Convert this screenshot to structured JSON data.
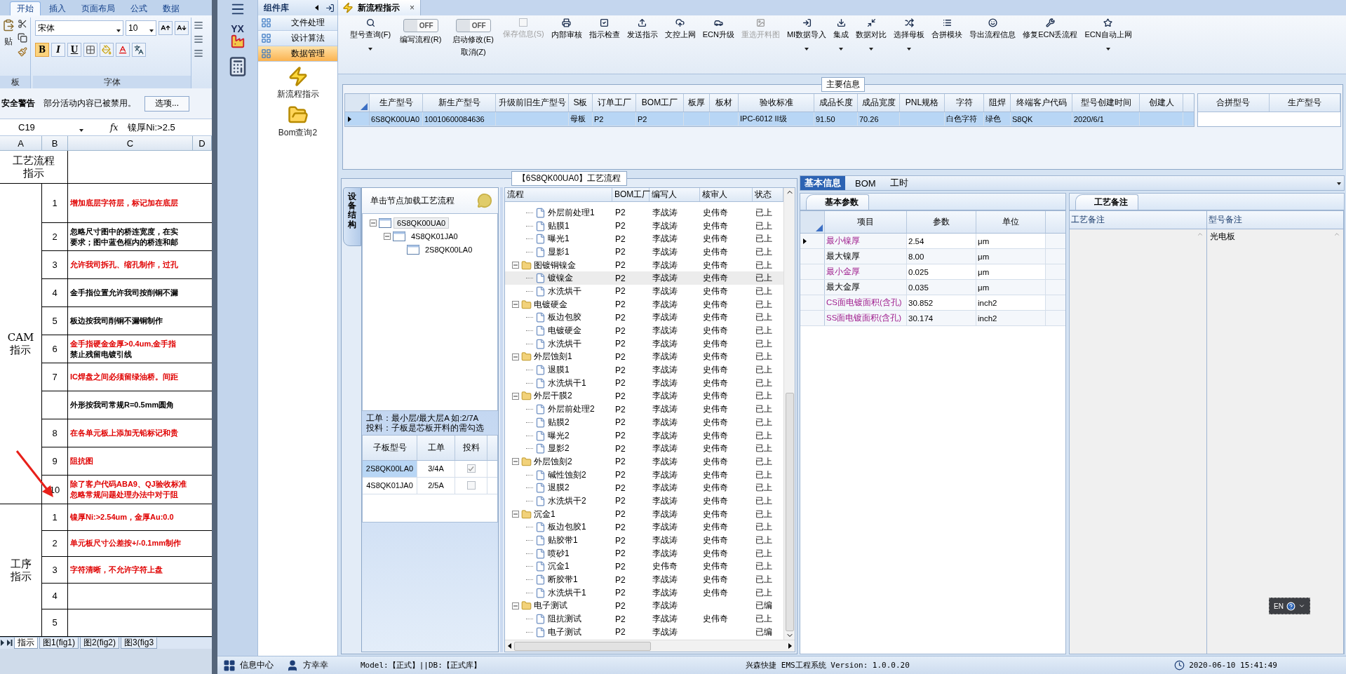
{
  "excel": {
    "ribbon_tabs": [
      {
        "label": "开始",
        "selected": true
      },
      {
        "label": "插入",
        "selected": false
      },
      {
        "label": "页面布局",
        "selected": false
      },
      {
        "label": "公式",
        "selected": false
      },
      {
        "label": "数据",
        "selected": false
      }
    ],
    "clipboard": {
      "paste_label": "贴",
      "group_label": "板"
    },
    "font": {
      "name": "宋体",
      "size": "10",
      "format_buttons": [
        "B",
        "I",
        "U"
      ],
      "group_label": "字体"
    },
    "security": {
      "title": "安全警告",
      "message": "部分活动内容已被禁用。",
      "button": "选项..."
    },
    "formula": {
      "cell": "C19",
      "fx": "fx",
      "value": "镍厚Ni:>2.5"
    },
    "columns": [
      "A",
      "B",
      "C",
      "D"
    ],
    "header": {
      "title_lines": [
        "工艺流程",
        "指示"
      ]
    },
    "sections": [
      {
        "title_lines": [
          "CAM",
          "指示"
        ],
        "rows": [
          {
            "no": "1",
            "lines": [
              {
                "text": "增加底层字符层，标记加在底层",
                "color": "#e00000"
              }
            ]
          },
          {
            "no": "2",
            "lines": [
              {
                "text": "忽略尺寸图中的桥连宽度，在实",
                "color": "#000000"
              },
              {
                "text": "要求；图中蓝色框内的桥连和邮",
                "color": "#000000"
              }
            ]
          },
          {
            "no": "3",
            "lines": [
              {
                "text": "允许我司拆孔、缩孔制作，过孔",
                "color": "#e00000"
              }
            ]
          },
          {
            "no": "4",
            "lines": [
              {
                "text": "金手指位置允许我司按削铜不漏",
                "color": "#000000"
              }
            ]
          },
          {
            "no": "5",
            "lines": [
              {
                "text": "板边按我司削铜不漏铜制作",
                "color": "#000000"
              }
            ]
          },
          {
            "no": "6",
            "lines": [
              {
                "text": "金手指硬金金厚>0.4um,金手指",
                "color": "#e00000"
              },
              {
                "text": "禁止残留电镀引线",
                "color": "#000000"
              }
            ]
          },
          {
            "no": "7",
            "lines": [
              {
                "text": "IC焊盘之间必须留绿油桥。间距",
                "color": "#e00000"
              }
            ]
          },
          {
            "lines": [
              {
                "text": "外形按我司常规R=0.5mm圆角",
                "color": "#000000"
              }
            ]
          },
          {
            "no": "8",
            "lines": [
              {
                "text": "在各单元板上添加无铅标记和贵",
                "color": "#e00000"
              }
            ]
          },
          {
            "no": "9",
            "lines": [
              {
                "text": "阻抗图",
                "color": "#e00000"
              }
            ]
          },
          {
            "no": "10",
            "lines": [
              {
                "text": "除了客户代码ABA9、QJ验收标准",
                "color": "#e00000"
              },
              {
                "text": "忽略常规问题处理办法中对于阻",
                "color": "#e00000"
              }
            ]
          }
        ]
      },
      {
        "title_lines": [
          "工序",
          "指示"
        ],
        "rows": [
          {
            "no": "1",
            "lines": [
              {
                "text": "镍厚Ni:>2.54um，金厚Au:0.0",
                "color": "#e00000"
              }
            ]
          },
          {
            "no": "2",
            "lines": [
              {
                "text": "单元板尺寸公差按+/-0.1mm制作",
                "color": "#e00000"
              }
            ]
          },
          {
            "no": "3",
            "lines": [
              {
                "text": "字符清晰，不允许字符上盘",
                "color": "#e00000"
              }
            ]
          },
          {
            "no": "4"
          },
          {
            "no": "5"
          }
        ]
      }
    ],
    "sheet_tabs": [
      {
        "label": "指示",
        "selected": true
      },
      {
        "label": "图1(fig1)",
        "selected": false
      },
      {
        "label": "图2(fig2)",
        "selected": false
      },
      {
        "label": "图3(fig3",
        "selected": false
      }
    ]
  },
  "app": {
    "rail": {
      "logo_text": "YX"
    },
    "component_library": {
      "title": "组件库",
      "categories": [
        {
          "label": "文件处理",
          "selected": false
        },
        {
          "label": "设计算法",
          "selected": false
        },
        {
          "label": "数据管理",
          "selected": true
        }
      ],
      "items": [
        {
          "label": "新流程指示",
          "kind": "lightning"
        },
        {
          "label": "Bom查询2",
          "kind": "folder"
        }
      ]
    },
    "doc_tab": {
      "label": "新流程指示",
      "close": "×"
    },
    "toolbar": [
      {
        "kind": "button",
        "label": "型号查询(F)",
        "dropdown": true,
        "disabled": false
      },
      {
        "kind": "toggle",
        "label": "编写流程(R)",
        "switch_text": "OFF",
        "on": false
      },
      {
        "kind": "toggle",
        "label": "启动修改(E)",
        "sublabel": "取消(Z)",
        "switch_text": "OFF",
        "on": false
      },
      {
        "kind": "button",
        "label": "保存信息(S)",
        "dropdown": false,
        "disabled": true
      },
      {
        "kind": "button",
        "label": "内部审核",
        "dropdown": false,
        "disabled": false
      },
      {
        "kind": "button",
        "label": "指示检查",
        "dropdown": false,
        "disabled": false
      },
      {
        "kind": "button",
        "label": "发送指示",
        "dropdown": false,
        "disabled": false
      },
      {
        "kind": "button",
        "label": "文控上网",
        "dropdown": false,
        "disabled": false
      },
      {
        "kind": "button",
        "label": "ECN升级",
        "dropdown": false,
        "disabled": false
      },
      {
        "kind": "button",
        "label": "重选开料图",
        "dropdown": false,
        "disabled": true
      },
      {
        "kind": "button",
        "label": "MI数据导入",
        "dropdown": true,
        "disabled": false
      },
      {
        "kind": "button",
        "label": "集成",
        "dropdown": true,
        "disabled": false
      },
      {
        "kind": "button",
        "label": "数据对比",
        "dropdown": true,
        "disabled": false
      },
      {
        "kind": "button",
        "label": "选择母板",
        "dropdown": true,
        "disabled": false
      },
      {
        "kind": "button",
        "label": "合拼模块",
        "dropdown": false,
        "disabled": false
      },
      {
        "kind": "button",
        "label": "导出流程信息",
        "dropdown": false,
        "disabled": false
      },
      {
        "kind": "button",
        "label": "修复ECN丢流程",
        "dropdown": false,
        "disabled": false
      },
      {
        "kind": "button",
        "label": "ECN自动上网",
        "dropdown": true,
        "disabled": false
      }
    ],
    "main_info": {
      "title": "主要信息",
      "columns": [
        "生产型号",
        "新生产型号",
        "升级前旧生产型号",
        "S板",
        "订单工厂",
        "BOM工厂",
        "板厚",
        "板材",
        "验收标准",
        "成品长度",
        "成品宽度",
        "PNL规格",
        "字符",
        "阻焊",
        "终端客户代码",
        "型号创建时间",
        "创建人"
      ],
      "rows": [
        {
          "current": true,
          "cells": [
            "6S8QK00UA0",
            "10010600084636",
            "",
            "母板",
            "P2",
            "P2",
            "",
            "",
            "IPC-6012 II级",
            "91.50",
            "70.26",
            "",
            "白色字符",
            "绿色",
            "S8QK",
            "2020/6/1",
            ""
          ]
        }
      ],
      "side_columns": [
        "合拼型号",
        "生产型号"
      ]
    },
    "structure": {
      "side_tab": "设备结构",
      "hint": "单击节点加载工艺流程",
      "tree": [
        {
          "label": "6S8QK00UA0",
          "expanded": true,
          "selected": true,
          "children": [
            {
              "label": "4S8QK01JA0",
              "expanded": true,
              "selected": false,
              "children": [
                {
                  "label": "2S8QK00LA0",
                  "selected": false
                }
              ]
            }
          ]
        }
      ],
      "notes": [
        "工单：最小层/最大层A 如:2/7A",
        "投料：子板是芯板开料的需勾选"
      ],
      "sub_table": {
        "columns": [
          "子板型号",
          "工单",
          "投料"
        ],
        "rows": [
          {
            "cells": [
              "2S8QK00LA0",
              "3/4A"
            ],
            "checked": true,
            "selected": true
          },
          {
            "cells": [
              "4S8QK01JA0",
              "2/5A"
            ],
            "checked": false,
            "selected": false
          }
        ]
      }
    },
    "process": {
      "title": "【6S8QK00UA0】工艺流程",
      "columns": [
        "流程",
        "BOM工厂",
        "编写人",
        "核审人",
        "状态"
      ],
      "groups": [
        {
          "children": [
            {
              "name": "外层前处理1",
              "bom": "P2",
              "writer": "李战涛",
              "reviewer": "史伟奇",
              "status": "已上",
              "selected": false
            },
            {
              "name": "贴膜1",
              "bom": "P2",
              "writer": "李战涛",
              "reviewer": "史伟奇",
              "status": "已上",
              "selected": false
            },
            {
              "name": "曝光1",
              "bom": "P2",
              "writer": "李战涛",
              "reviewer": "史伟奇",
              "status": "已上",
              "selected": false
            },
            {
              "name": "显影1",
              "bom": "P2",
              "writer": "李战涛",
              "reviewer": "史伟奇",
              "status": "已上",
              "selected": false
            }
          ]
        },
        {
          "name": "图镀铜镍金",
          "bom": "P2",
          "writer": "李战涛",
          "reviewer": "史伟奇",
          "status": "已上",
          "expanded": true,
          "children": [
            {
              "name": "镀镍金",
              "bom": "P2",
              "writer": "李战涛",
              "reviewer": "史伟奇",
              "status": "已上",
              "selected": true
            },
            {
              "name": "水洗烘干",
              "bom": "P2",
              "writer": "李战涛",
              "reviewer": "史伟奇",
              "status": "已上",
              "selected": false
            }
          ]
        },
        {
          "name": "电镀硬金",
          "bom": "P2",
          "writer": "李战涛",
          "reviewer": "史伟奇",
          "status": "已上",
          "expanded": true,
          "children": [
            {
              "name": "板边包胶",
              "bom": "P2",
              "writer": "李战涛",
              "reviewer": "史伟奇",
              "status": "已上",
              "selected": false
            },
            {
              "name": "电镀硬金",
              "bom": "P2",
              "writer": "李战涛",
              "reviewer": "史伟奇",
              "status": "已上",
              "selected": false
            },
            {
              "name": "水洗烘干",
              "bom": "P2",
              "writer": "李战涛",
              "reviewer": "史伟奇",
              "status": "已上",
              "selected": false
            }
          ]
        },
        {
          "name": "外层蚀刻1",
          "bom": "P2",
          "writer": "李战涛",
          "reviewer": "史伟奇",
          "status": "已上",
          "expanded": true,
          "children": [
            {
              "name": "退膜1",
              "bom": "P2",
              "writer": "李战涛",
              "reviewer": "史伟奇",
              "status": "已上",
              "selected": false
            },
            {
              "name": "水洗烘干1",
              "bom": "P2",
              "writer": "李战涛",
              "reviewer": "史伟奇",
              "status": "已上",
              "selected": false
            }
          ]
        },
        {
          "name": "外层干膜2",
          "bom": "P2",
          "writer": "李战涛",
          "reviewer": "史伟奇",
          "status": "已上",
          "expanded": true,
          "children": [
            {
              "name": "外层前处理2",
              "bom": "P2",
              "writer": "李战涛",
              "reviewer": "史伟奇",
              "status": "已上",
              "selected": false
            },
            {
              "name": "贴膜2",
              "bom": "P2",
              "writer": "李战涛",
              "reviewer": "史伟奇",
              "status": "已上",
              "selected": false
            },
            {
              "name": "曝光2",
              "bom": "P2",
              "writer": "李战涛",
              "reviewer": "史伟奇",
              "status": "已上",
              "selected": false
            },
            {
              "name": "显影2",
              "bom": "P2",
              "writer": "李战涛",
              "reviewer": "史伟奇",
              "status": "已上",
              "selected": false
            }
          ]
        },
        {
          "name": "外层蚀刻2",
          "bom": "P2",
          "writer": "李战涛",
          "reviewer": "史伟奇",
          "status": "已上",
          "expanded": true,
          "children": [
            {
              "name": "碱性蚀刻2",
              "bom": "P2",
              "writer": "李战涛",
              "reviewer": "史伟奇",
              "status": "已上",
              "selected": false
            },
            {
              "name": "退膜2",
              "bom": "P2",
              "writer": "李战涛",
              "reviewer": "史伟奇",
              "status": "已上",
              "selected": false
            },
            {
              "name": "水洗烘干2",
              "bom": "P2",
              "writer": "李战涛",
              "reviewer": "史伟奇",
              "status": "已上",
              "selected": false
            }
          ]
        },
        {
          "name": "沉金1",
          "bom": "P2",
          "writer": "李战涛",
          "reviewer": "史伟奇",
          "status": "已上",
          "expanded": true,
          "children": [
            {
              "name": "板边包胶1",
              "bom": "P2",
              "writer": "李战涛",
              "reviewer": "史伟奇",
              "status": "已上",
              "selected": false
            },
            {
              "name": "贴胶带1",
              "bom": "P2",
              "writer": "李战涛",
              "reviewer": "史伟奇",
              "status": "已上",
              "selected": false
            },
            {
              "name": "喷砂1",
              "bom": "P2",
              "writer": "李战涛",
              "reviewer": "史伟奇",
              "status": "已上",
              "selected": false
            },
            {
              "name": "沉金1",
              "bom": "P2",
              "writer": "史伟奇",
              "reviewer": "史伟奇",
              "status": "已上",
              "selected": false
            },
            {
              "name": "断胶带1",
              "bom": "P2",
              "writer": "李战涛",
              "reviewer": "史伟奇",
              "status": "已上",
              "selected": false
            },
            {
              "name": "水洗烘干1",
              "bom": "P2",
              "writer": "李战涛",
              "reviewer": "史伟奇",
              "status": "已上",
              "selected": false
            }
          ]
        },
        {
          "name": "电子测试",
          "bom": "P2",
          "writer": "李战涛",
          "status": "已编",
          "expanded": true,
          "children": [
            {
              "name": "阻抗测试",
              "bom": "P2",
              "writer": "李战涛",
              "reviewer": "史伟奇",
              "status": "已上",
              "selected": false
            },
            {
              "name": "电子测试",
              "bom": "P2",
              "writer": "李战涛",
              "status": "已编",
              "selected": false
            }
          ]
        }
      ]
    },
    "info_tabs": [
      {
        "label": "基本信息",
        "selected": true
      },
      {
        "label": "BOM",
        "selected": false
      },
      {
        "label": "工时",
        "selected": false
      }
    ],
    "basic_params": {
      "tab": "基本参数",
      "columns": [
        "项目",
        "参数",
        "单位"
      ],
      "rows": [
        {
          "item": "最小镍厚",
          "value": "2.54",
          "unit": "μm",
          "highlighted": true,
          "current": true
        },
        {
          "item": "最大镍厚",
          "value": "8.00",
          "unit": "μm",
          "highlighted": false,
          "current": false
        },
        {
          "item": "最小金厚",
          "value": "0.025",
          "unit": "μm",
          "highlighted": true,
          "current": false
        },
        {
          "item": "最大金厚",
          "value": "0.035",
          "unit": "μm",
          "highlighted": false,
          "current": false
        },
        {
          "item": "CS面电镀面积(含孔)",
          "value": "30.852",
          "unit": "inch2",
          "highlighted": true,
          "current": false
        },
        {
          "item": "SS面电镀面积(含孔)",
          "value": "30.174",
          "unit": "inch2",
          "highlighted": true,
          "current": false
        }
      ]
    },
    "remarks": {
      "tab": "工艺备注",
      "columns": [
        "工艺备注",
        "型号备注"
      ],
      "model_remark": "光电板"
    },
    "lang_widget": {
      "label": "EN"
    },
    "status_bar": {
      "info_center": "信息中心",
      "user": "方幸幸",
      "model": "Model:【正式】||DB:【正式库】",
      "system": "兴森快捷 EMS工程系统 Version: 1.0.0.20",
      "time": "2020-06-10 15:41:49"
    }
  }
}
